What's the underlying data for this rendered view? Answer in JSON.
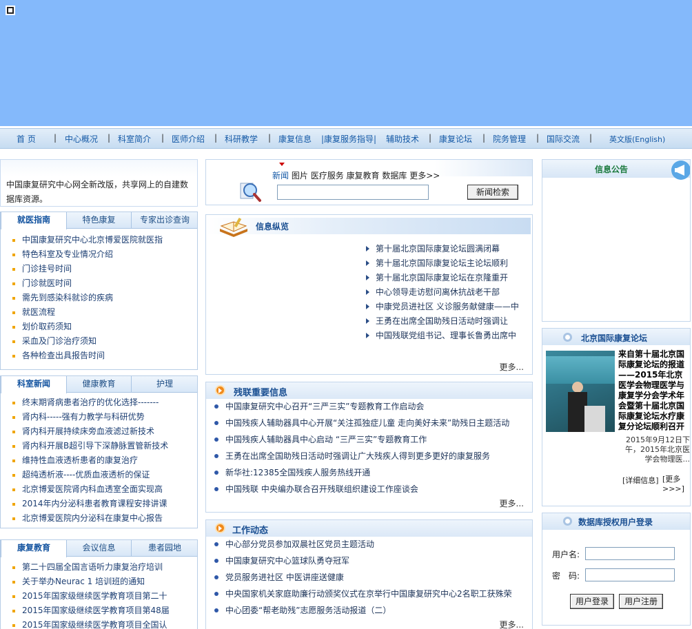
{
  "nav": {
    "items": [
      "首 页",
      "中心概况",
      "科室简介",
      "医师介绍",
      "科研教学",
      "康复信息",
      "|康复服务指导|",
      "辅助技术",
      "康复论坛",
      "院务管理",
      "国际交流",
      "英文版(English)"
    ]
  },
  "intro": {
    "text": "中国康复研究中心网全新改版，共享网上的自建数据库资源。"
  },
  "guide": {
    "tabs": [
      "就医指南",
      "特色康复",
      "专家出诊查询"
    ],
    "items": [
      "中国康复研究中心北京博爱医院就医指",
      "特色科室及专业情况介绍",
      "门诊挂号时间",
      "门诊就医时间",
      "需先到感染科就诊的疾病",
      "就医流程",
      "划价取药须知",
      "采血及门诊治疗须知",
      "各种检查出具报告时间"
    ]
  },
  "dept_news": {
    "tabs": [
      "科室新闻",
      "健康教育",
      "护理"
    ],
    "items": [
      "终末期肾病患者治疗的优化选择-------",
      "肾内科-----强有力教学与科研优势",
      "肾内科开展持续床旁血液滤过新技术",
      "肾内科开展B超引导下深静脉置管新技术",
      "维持性血液透析患者的康复治疗",
      "超纯透析液----优质血液透析的保证",
      "北京博爱医院肾内科血透室全面实现高",
      "2014年内分泌科患者教育课程安排讲课",
      "北京博爱医院内分泌科在康复中心报告"
    ]
  },
  "rehab_edu": {
    "tabs": [
      "康复教育",
      "会议信息",
      "患者园地"
    ],
    "items": [
      "第二十四届全国言语听力康复治疗培训",
      "关于举办Neurac 1 培训班的通知",
      "2015年国家级继续医学教育项目第二十",
      "2015年国家级继续医学教育项目第48届",
      "2015年国家级继续医学教育项目全国认"
    ]
  },
  "search": {
    "tabs": [
      "新闻",
      "图片",
      "医疗服务",
      "康复教育",
      "数据库",
      "更多>>"
    ],
    "button": "新闻检索"
  },
  "info_overview": {
    "title": "信息纵览",
    "items": [
      "第十届北京国际康复论坛圆满闭幕",
      "第十届北京国际康复论坛主论坛顺利",
      "第十届北京国际康复论坛在京隆重开",
      "中心领导走访慰问离休抗战老干部",
      "中康党员进社区 义诊服务献健康——中",
      "王勇在出席全国助残日活动时强调让",
      "中国残联党组书记、理事长鲁勇出席中"
    ],
    "more": "更多..."
  },
  "disability_news": {
    "title": "残联重要信息",
    "items": [
      "中国康复研究中心召开“三严三实”专题教育工作启动会",
      "中国残疾人辅助器具中心开展“关注孤独症儿童 走向美好未来”助残日主题活动",
      "中国残疾人辅助器具中心启动 “三严三实”专题教育工作",
      "王勇在出席全国助残日活动时强调让广大残疾人得到更多更好的康复服务",
      "新华社:12385全国残疾人服务热线开通",
      "中国残联 中央编办联合召开残联组织建设工作座谈会"
    ],
    "more": "更多..."
  },
  "work_news": {
    "title": "工作动态",
    "items": [
      "中心部分党员参加双晨社区党员主题活动",
      "中国康复研究中心篮球队勇夺冠军",
      "党员服务进社区 中医讲座送健康",
      "中央国家机关家庭助廉行动颁奖仪式在京举行中国康复研究中心2名职工获殊荣",
      "中心团委“帮老助残”志愿服务活动报道（二）"
    ],
    "more": "更多..."
  },
  "notice": {
    "title": "信息公告"
  },
  "forum": {
    "title": "北京国际康复论坛",
    "headline": "来自第十届北京国际康复论坛的报道——2015年北京医学会物理医学与康复学分会学术年会暨第十届北京国际康复论坛水疗康复分论坛顺利召开",
    "desc": "2015年9月12日下午，2015年北京医学会物理医...",
    "detail": "[详细信息]",
    "more": "[更多>>>]"
  },
  "login": {
    "title": "数据库授权用户登录",
    "username_label": "用户名:",
    "password_label": "密　码:",
    "login_button": "用户登录",
    "register_button": "用户注册"
  },
  "colors": {
    "banner": "#84b9fb",
    "nav_text": "#1459a6",
    "accent": "#f08a1c",
    "link": "#1d3f73"
  }
}
